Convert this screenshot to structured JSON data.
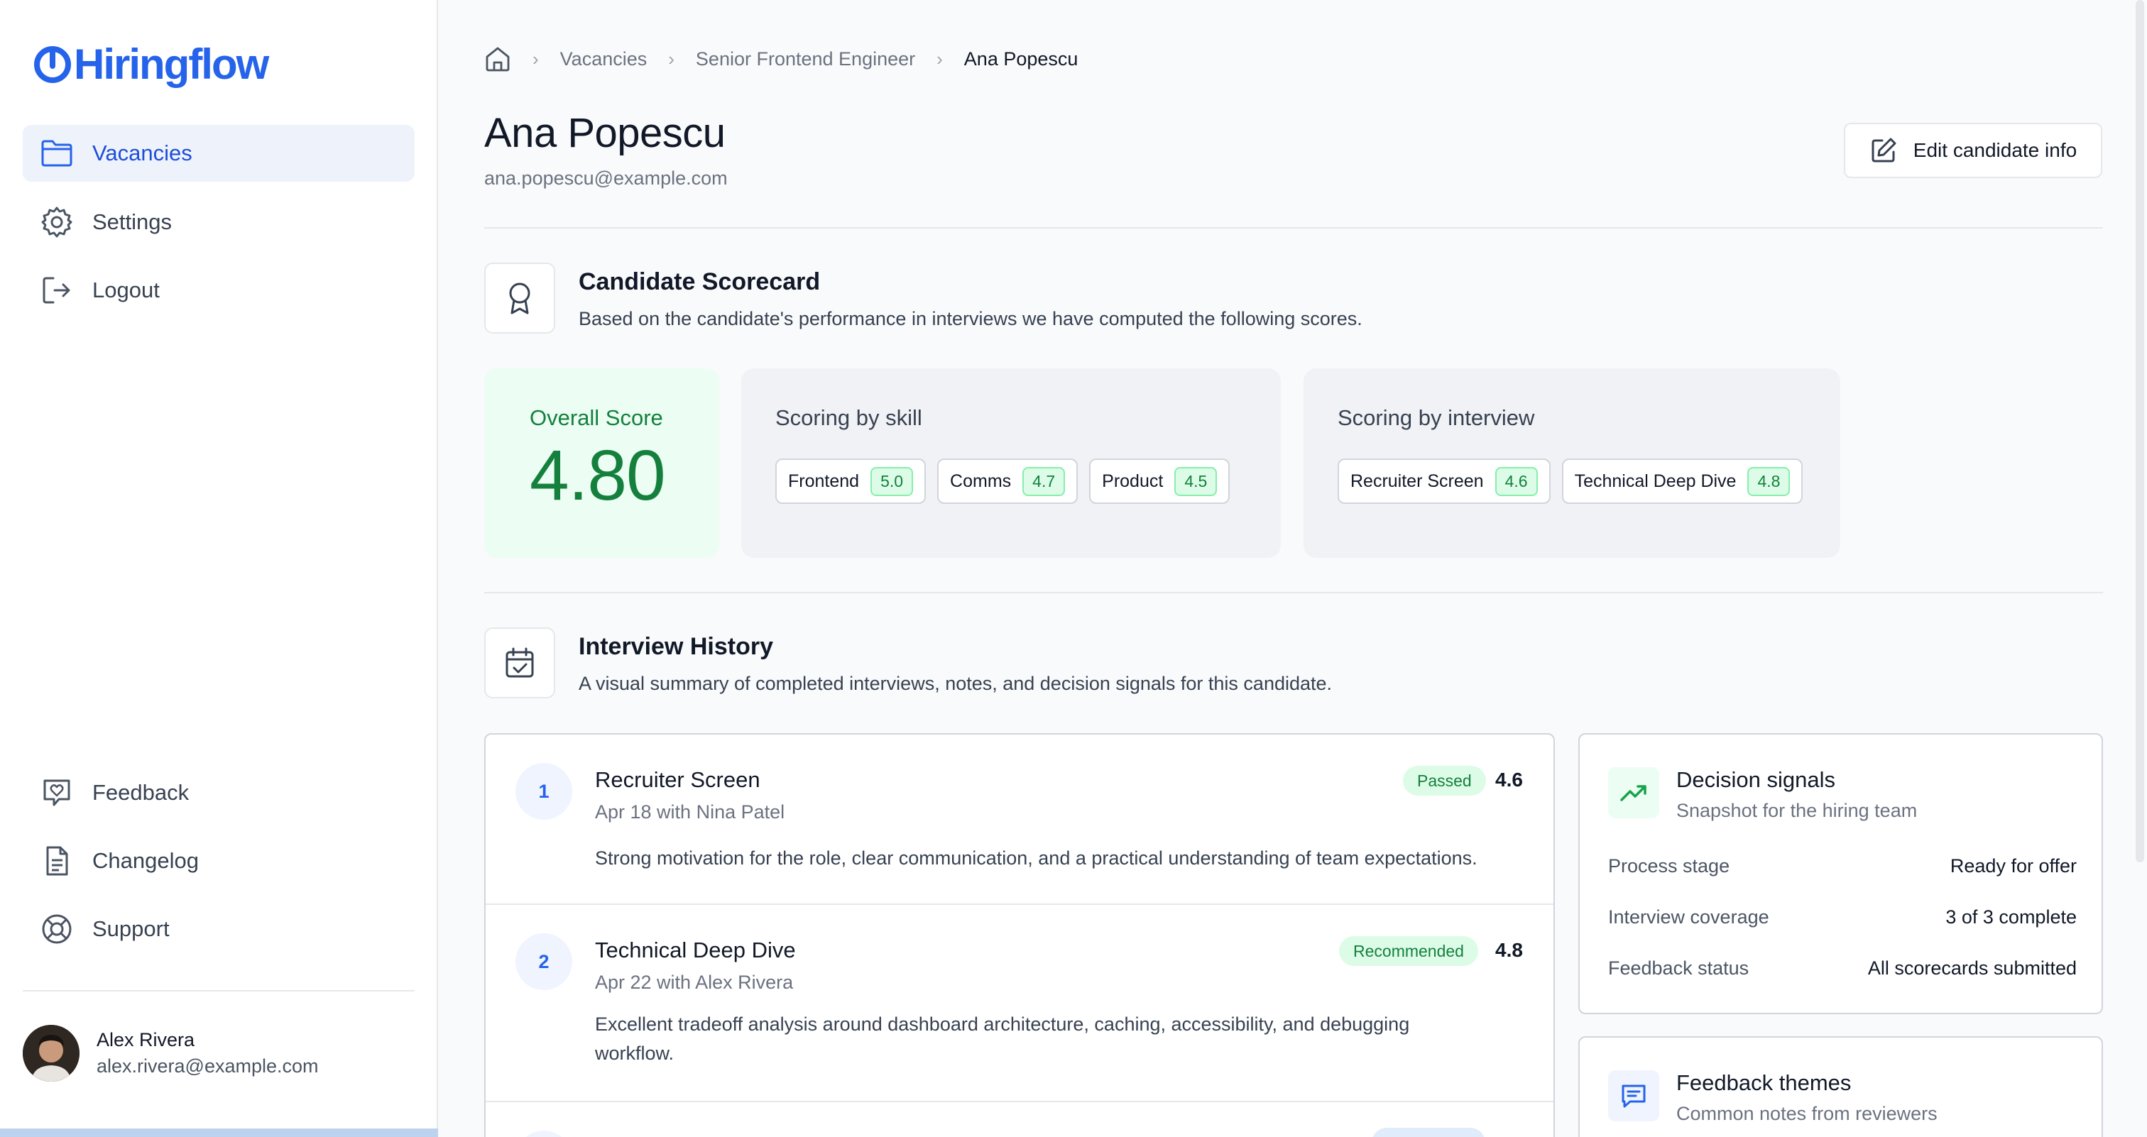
{
  "app": {
    "name": "Hiringflow",
    "accent": "#2563eb"
  },
  "sidebar": {
    "nav": [
      {
        "label": "Vacancies",
        "icon": "folder-icon"
      },
      {
        "label": "Settings",
        "icon": "gear-icon"
      },
      {
        "label": "Logout",
        "icon": "logout-icon"
      }
    ],
    "bottom_nav": [
      {
        "label": "Feedback",
        "icon": "heart-message-icon"
      },
      {
        "label": "Changelog",
        "icon": "document-icon"
      },
      {
        "label": "Support",
        "icon": "lifebuoy-icon"
      }
    ],
    "user": {
      "name": "Alex Rivera",
      "email": "alex.rivera@example.com"
    }
  },
  "breadcrumb": [
    "Vacancies",
    "Senior Frontend Engineer",
    "Ana Popescu"
  ],
  "candidate": {
    "name": "Ana Popescu",
    "email": "ana.popescu@example.com",
    "edit_label": "Edit candidate info"
  },
  "scorecard": {
    "title": "Candidate Scorecard",
    "subtitle": "Based on the candidate's performance in interviews we have computed the following scores.",
    "overall_label": "Overall Score",
    "overall_value": "4.80",
    "by_skill_title": "Scoring by skill",
    "skills": [
      {
        "name": "Frontend",
        "score": "5.0"
      },
      {
        "name": "Comms",
        "score": "4.7"
      },
      {
        "name": "Product",
        "score": "4.5"
      }
    ],
    "by_interview_title": "Scoring by interview",
    "interviews": [
      {
        "name": "Recruiter Screen",
        "score": "4.6"
      },
      {
        "name": "Technical Deep Dive",
        "score": "4.8"
      }
    ]
  },
  "history": {
    "title": "Interview History",
    "subtitle": "A visual summary of completed interviews, notes, and decision signals for this candidate.",
    "items": [
      {
        "number": "1",
        "title": "Recruiter Screen",
        "date": "Apr 18 with Nina Patel",
        "status": "Passed",
        "score": "4.6",
        "note": "Strong motivation for the role, clear communication, and a practical understanding of team expectations."
      },
      {
        "number": "2",
        "title": "Technical Deep Dive",
        "date": "Apr 22 with Alex Rivera",
        "status": "Recommended",
        "score": "4.8",
        "note": "Excellent tradeoff analysis around dashboard architecture, caching, accessibility, and debugging workflow."
      }
    ]
  },
  "decision_signals": {
    "title": "Decision signals",
    "subtitle": "Snapshot for the hiring team",
    "rows": [
      {
        "key": "Process stage",
        "value": "Ready for offer"
      },
      {
        "key": "Interview coverage",
        "value": "3 of 3 complete"
      },
      {
        "key": "Feedback status",
        "value": "All scorecards submitted"
      }
    ]
  },
  "feedback_themes": {
    "title": "Feedback themes",
    "subtitle": "Common notes from reviewers"
  }
}
